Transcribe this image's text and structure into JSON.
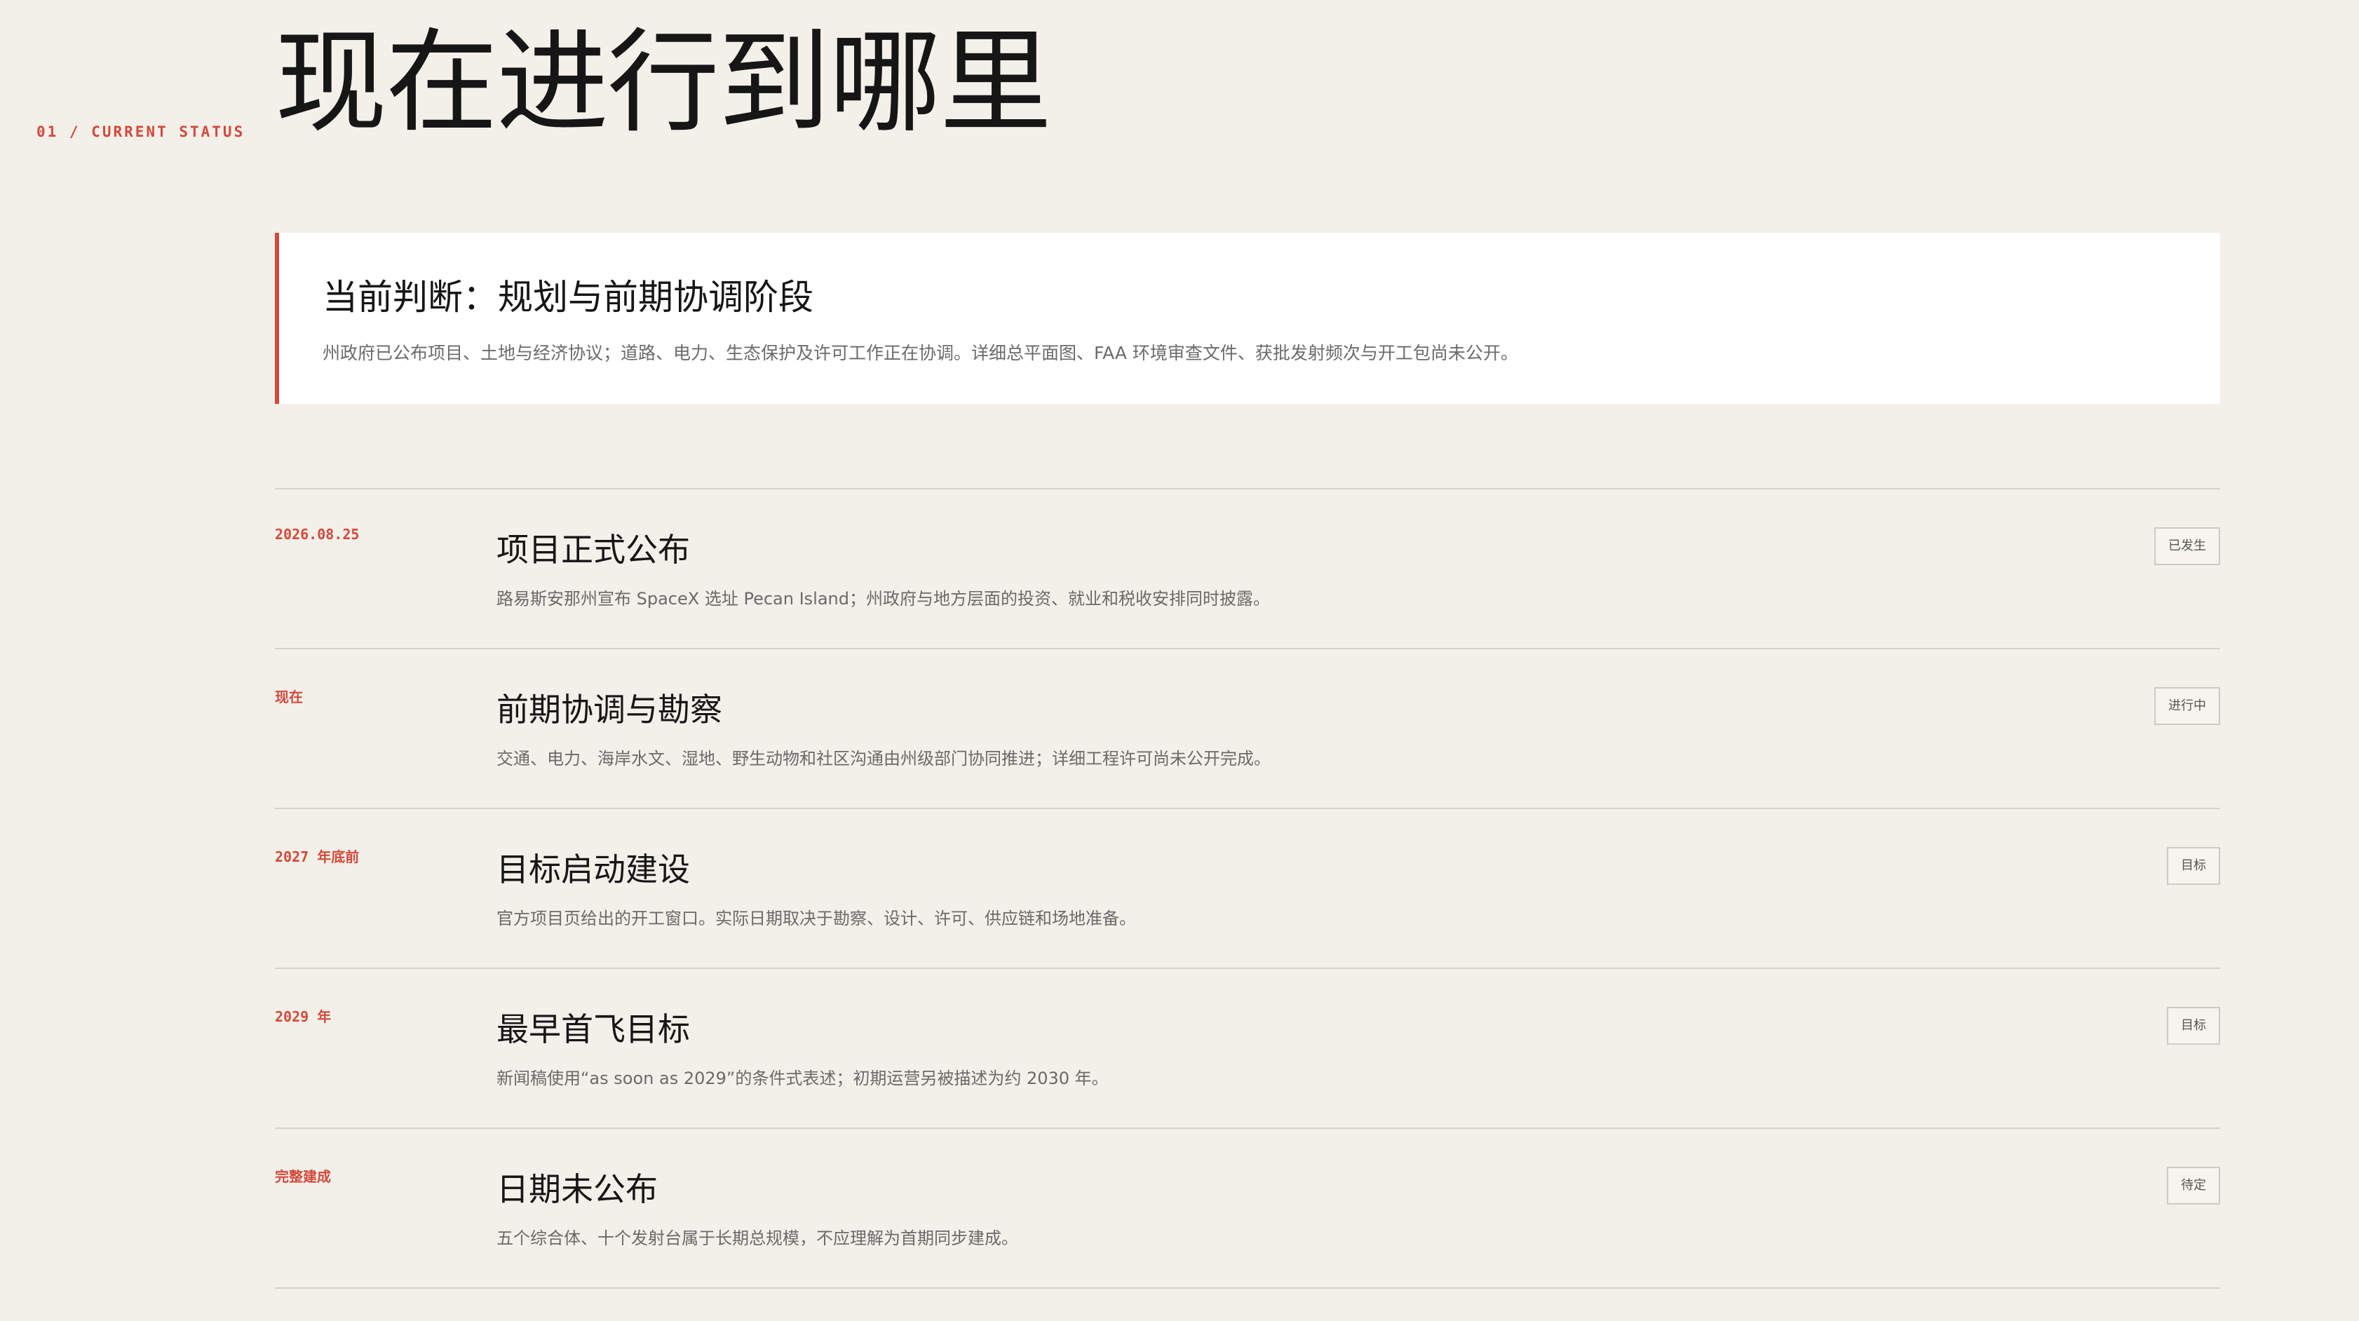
{
  "header": {
    "section_label": "01 / CURRENT STATUS",
    "title": "现在进行到哪里"
  },
  "summary": {
    "heading": "当前判断：规划与前期协调阶段",
    "text": "州政府已公布项目、土地与经济协议；道路、电力、生态保护及许可工作正在协调。详细总平面图、FAA 环境审查文件、获批发射频次与开工包尚未公开。",
    "accent_color": "#d4493a"
  },
  "timeline": [
    {
      "date": "2026.08.25",
      "title": "项目正式公布",
      "desc": "路易斯安那州宣布 SpaceX 选址 Pecan Island；州政府与地方层面的投资、就业和税收安排同时披露。",
      "badge": "已发生"
    },
    {
      "date": "现在",
      "title": "前期协调与勘察",
      "desc": "交通、电力、海岸水文、湿地、野生动物和社区沟通由州级部门协同推进；详细工程许可尚未公开完成。",
      "badge": "进行中"
    },
    {
      "date": "2027 年底前",
      "title": "目标启动建设",
      "desc": "官方项目页给出的开工窗口。实际日期取决于勘察、设计、许可、供应链和场地准备。",
      "badge": "目标"
    },
    {
      "date": "2029 年",
      "title": "最早首飞目标",
      "desc": "新闻稿使用“as soon as 2029”的条件式表述；初期运营另被描述为约 2030 年。",
      "badge": "目标"
    },
    {
      "date": "完整建成",
      "title": "日期未公布",
      "desc": "五个综合体、十个发射台属于长期总规模，不应理解为首期同步建成。",
      "badge": "待定"
    }
  ]
}
